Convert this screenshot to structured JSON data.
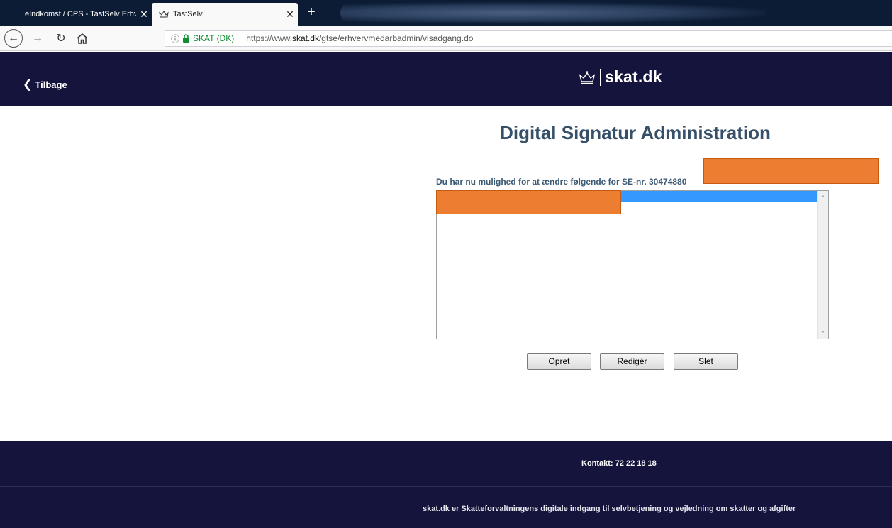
{
  "browser": {
    "tabs": [
      {
        "title": "eIndkomst / CPS - TastSelv Erhv",
        "active": false
      },
      {
        "title": "TastSelv",
        "active": true
      }
    ],
    "close_glyph": "✕",
    "new_tab_glyph": "+",
    "url": {
      "info_glyph": "ⓘ",
      "org": "SKAT (DK)",
      "prefix": "https://www.",
      "domain": "skat.dk",
      "path": "/gtse/erhvervmedarbadmin/visadgang.do"
    }
  },
  "header": {
    "back_label": "Tilbage",
    "brand": "skat.dk",
    "background": "#14143c"
  },
  "main": {
    "title": "Digital Signatur Administration",
    "intro": "Du har nu mulighed for at ændre følgende for SE-nr. 30474880",
    "list": {
      "items": [
        ""
      ],
      "selected_color": "#3399ff"
    },
    "buttons": {
      "opret": {
        "accel": "O",
        "rest": "pret"
      },
      "rediger": {
        "accel": "R",
        "rest": "edigér"
      },
      "slet": {
        "accel": "S",
        "rest": "let"
      }
    },
    "redaction_color": "#ed7d31"
  },
  "footer": {
    "contact": "Kontakt: 72 22 18 18",
    "tagline": "skat.dk er Skatteforvaltningens digitale indgang til selvbetjening og vejledning om skatter og afgifter"
  }
}
